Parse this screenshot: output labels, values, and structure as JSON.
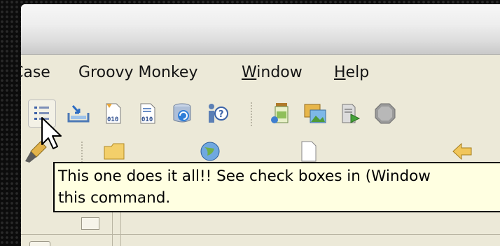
{
  "menu": {
    "items": [
      {
        "label": "Case",
        "underline": "",
        "rest": "Case"
      },
      {
        "label": "Groovy Monkey",
        "underline": "",
        "rest": "Groovy Monkey"
      },
      {
        "label": "Window",
        "underline": "W",
        "rest": "indow"
      },
      {
        "label": "Help",
        "underline": "H",
        "rest": "elp"
      }
    ]
  },
  "toolbar": {
    "row1_icons": [
      "task-list-icon",
      "import-icon",
      "binary-file-icon",
      "binary-file-2-icon",
      "refresh-database-icon",
      "help-info-icon",
      "jar-icon",
      "image-icon",
      "run-script-icon",
      "stop-icon"
    ],
    "row2_icons": [
      "brush-icon",
      "folder-icon",
      "globe-icon",
      "document-icon",
      "back-arrow-icon"
    ]
  },
  "tooltip": {
    "line1": "This one does it all!! See check boxes in (Window",
    "line2": "this command."
  },
  "colors": {
    "chrome": "#ece9d8",
    "tooltip_bg": "#ffffe1",
    "frame": "#0c0c0c"
  }
}
